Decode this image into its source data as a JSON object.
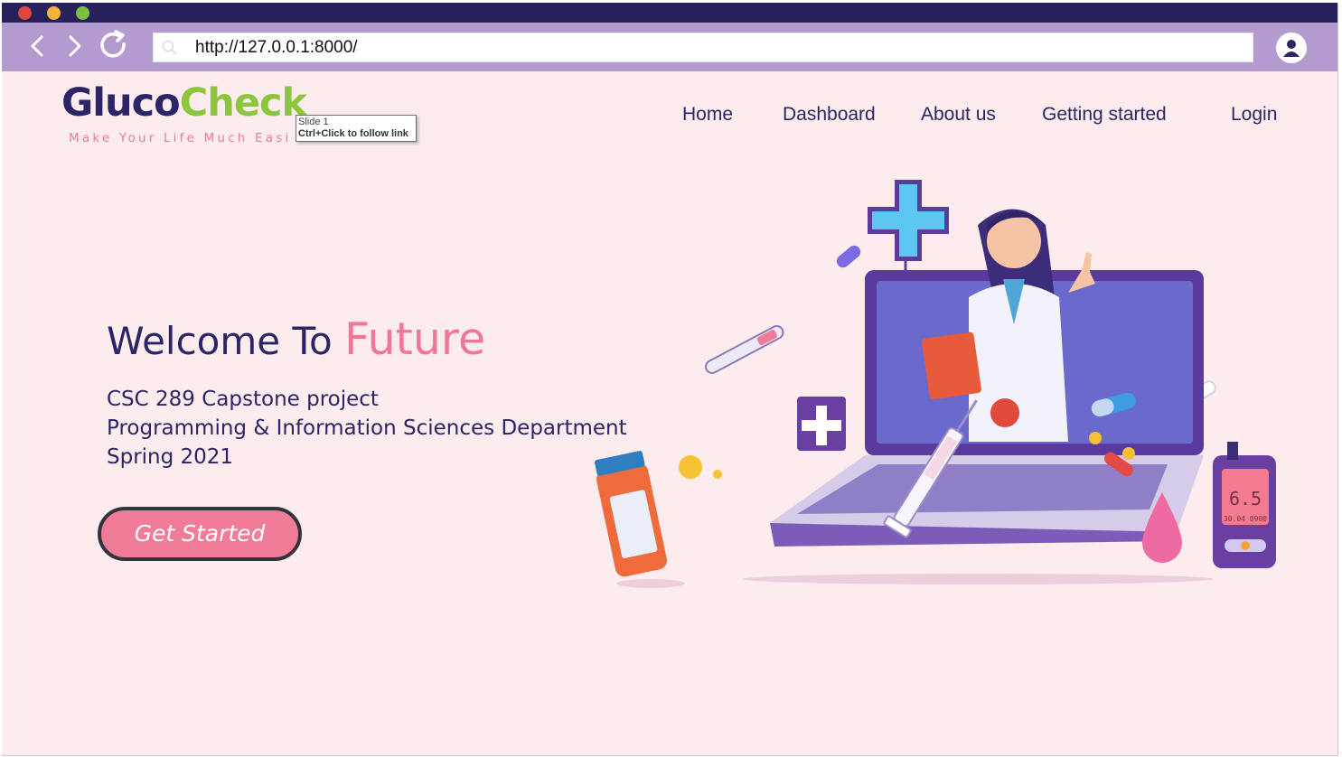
{
  "browser": {
    "url": "http://127.0.0.1:8000/",
    "colors": {
      "titlebar": "#27215a",
      "toolbar": "#b39bd0",
      "close": "#e0463c",
      "minimize": "#f2b33a",
      "maximize": "#7ac043"
    }
  },
  "header": {
    "logo": {
      "part1": "Gluco",
      "part2": "Check",
      "tagline": "Make Your Life Much Easier"
    },
    "tooltip": {
      "line1": "Slide 1",
      "line2": "Ctrl+Click to follow link"
    },
    "nav": [
      "Home",
      "Dashboard",
      "About us",
      "Getting started",
      "Login"
    ]
  },
  "hero": {
    "title_prefix": "Welcome To ",
    "title_accent": "Future",
    "lines": [
      "CSC 289 Capstone project",
      "Programming & Information Sciences Department",
      "Spring 2021"
    ],
    "cta_label": "Get Started"
  },
  "illustration": {
    "meter_value": "6.5",
    "meter_date": "30.04 0900"
  },
  "colors": {
    "page_bg": "#fdeced",
    "navy": "#2b2467",
    "pink": "#f07c98",
    "green": "#8cc63f"
  }
}
